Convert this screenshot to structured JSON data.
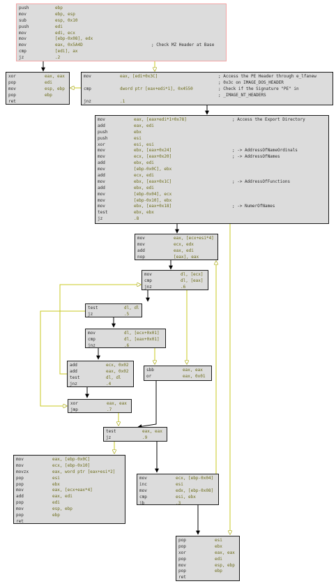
{
  "blocks": {
    "entry": [
      {
        "m": "push",
        "o": "ebp"
      },
      {
        "m": "mov",
        "o": "ebp, esp"
      },
      {
        "m": "sub",
        "o": "esp, 0x10"
      },
      {
        "m": "push",
        "o": "edi"
      },
      {
        "m": "mov",
        "o": "edi, ecx"
      },
      {
        "m": "mov",
        "o": "[ebp-0x08], edx"
      },
      {
        "m": "mov",
        "o": "eax, 0x5A4D",
        "c": "; Check MZ Header at Base"
      },
      {
        "m": "cmp",
        "o": "[edi], ax"
      },
      {
        "m": "jz",
        "o": ".2"
      }
    ],
    "fail1": [
      {
        "m": "xor",
        "o": "eax, eax"
      },
      {
        "m": "pop",
        "o": "edi"
      },
      {
        "m": "mov",
        "o": "esp, ebp"
      },
      {
        "m": "pop",
        "o": "ebp"
      },
      {
        "m": "ret",
        "o": ""
      }
    ],
    "pe": [
      {
        "m": "mov",
        "o": "eax, [edi+0x3C]",
        "c": "; Access the PE Header through e_lfanew"
      },
      {
        "m": "",
        "o": "",
        "c": "; 0x3c on IMAGE_DOS_HEADER"
      },
      {
        "m": "cmp",
        "o": "dword ptr [eax+edi*1], 0x4550",
        "c": "; Check if the Signature \"PE\" in"
      },
      {
        "m": "",
        "o": "",
        "c": "; _IMAGE_NT_HEADERS"
      },
      {
        "m": "jnz",
        "o": ".1"
      }
    ],
    "export": [
      {
        "m": "mov",
        "o": "eax, [eax+edi*1+0x78]",
        "c": "; Access the Export Directory"
      },
      {
        "m": "add",
        "o": "eax, edi"
      },
      {
        "m": "push",
        "o": "ebx"
      },
      {
        "m": "push",
        "o": "esi"
      },
      {
        "m": "xor",
        "o": "esi, esi"
      },
      {
        "m": "mov",
        "o": "ebx, [eax+0x24]",
        "c": "; -> AddressOfNameOrdinals"
      },
      {
        "m": "mov",
        "o": "ecx, [eax+0x20]",
        "c": "; -> AddressOfNames"
      },
      {
        "m": "add",
        "o": "ebx, edi"
      },
      {
        "m": "mov",
        "o": "[ebp-0x0C], ebx"
      },
      {
        "m": "add",
        "o": "ecx, edi"
      },
      {
        "m": "mov",
        "o": "ebx, [eax+0x1C]",
        "c": "; -> AddressOfFunctions"
      },
      {
        "m": "add",
        "o": "ebx, edi"
      },
      {
        "m": "mov",
        "o": "[ebp-0x04], ecx"
      },
      {
        "m": "mov",
        "o": "[ebp-0x10], ebx"
      },
      {
        "m": "mov",
        "o": "ebx, [eax+0x18]",
        "c": "; -> NumerOfNames"
      },
      {
        "m": "test",
        "o": "ebx, ebx"
      },
      {
        "m": "jz",
        "o": ".8"
      }
    ],
    "b8": [
      {
        "m": "mov",
        "o": "eax, [ecx+esi*4]"
      },
      {
        "m": "mov",
        "o": "ecx, edx"
      },
      {
        "m": "add",
        "o": "eax, edi"
      },
      {
        "m": "nop",
        "o": "[eax], eax"
      }
    ],
    "b6": [
      {
        "m": "mov",
        "o": "dl, [ecx]"
      },
      {
        "m": "cmp",
        "o": "dl, [eax]"
      },
      {
        "m": "jnz",
        "o": ".6"
      }
    ],
    "b5": [
      {
        "m": "test",
        "o": "dl, dl"
      },
      {
        "m": "jz",
        "o": ".5"
      }
    ],
    "b4": [
      {
        "m": "mov",
        "o": "dl, [ecx+0x01]"
      },
      {
        "m": "cmp",
        "o": "dl, [eax+0x01]"
      },
      {
        "m": "jnz",
        "o": ".6"
      }
    ],
    "b3": [
      {
        "m": "add",
        "o": "ecx, 0x02"
      },
      {
        "m": "add",
        "o": "eax, 0x02"
      },
      {
        "m": "test",
        "o": "dl, dl"
      },
      {
        "m": "jnz",
        "o": ".4"
      }
    ],
    "sbb": [
      {
        "m": "sbb",
        "o": "eax, eax"
      },
      {
        "m": "or",
        "o": "eax, 0x01"
      }
    ],
    "xorjmp": [
      {
        "m": "xor",
        "o": "eax, eax"
      },
      {
        "m": "jmp",
        "o": ".7"
      }
    ],
    "b7": [
      {
        "m": "test",
        "o": "eax, eax"
      },
      {
        "m": "jz",
        "o": ".9"
      }
    ],
    "found": [
      {
        "m": "mov",
        "o": "eax, [ebp-0x0C]"
      },
      {
        "m": "mov",
        "o": "ecx, [ebp-0x10]"
      },
      {
        "m": "movzx",
        "o": "eax, word ptr [eax+esi*2]"
      },
      {
        "m": "pop",
        "o": "esi"
      },
      {
        "m": "pop",
        "o": "ebx"
      },
      {
        "m": "mov",
        "o": "eax, [ecx+eax*4]"
      },
      {
        "m": "add",
        "o": "eax, edi"
      },
      {
        "m": "pop",
        "o": "edi"
      },
      {
        "m": "mov",
        "o": "esp, ebp"
      },
      {
        "m": "pop",
        "o": "ebp"
      },
      {
        "m": "ret",
        "o": ""
      }
    ],
    "loop": [
      {
        "m": "mov",
        "o": "ecx, [ebp-0x04]"
      },
      {
        "m": "inc",
        "o": "esi"
      },
      {
        "m": "mov",
        "o": "edx, [ebp-0x08]"
      },
      {
        "m": "cmp",
        "o": "esi, ebx"
      },
      {
        "m": "jb",
        "o": ".3"
      }
    ],
    "fail2": [
      {
        "m": "pop",
        "o": "esi"
      },
      {
        "m": "pop",
        "o": "ebx"
      },
      {
        "m": "xor",
        "o": "eax, eax"
      },
      {
        "m": "pop",
        "o": "edi"
      },
      {
        "m": "mov",
        "o": "esp, ebp"
      },
      {
        "m": "pop",
        "o": "ebp"
      },
      {
        "m": "ret",
        "o": ""
      }
    ]
  },
  "colors": {
    "taken_edge": "#c8c820",
    "fallthrough_edge": "#000000",
    "block_bg": "#dcdcdc",
    "entry_border": "#f2a4a4"
  }
}
